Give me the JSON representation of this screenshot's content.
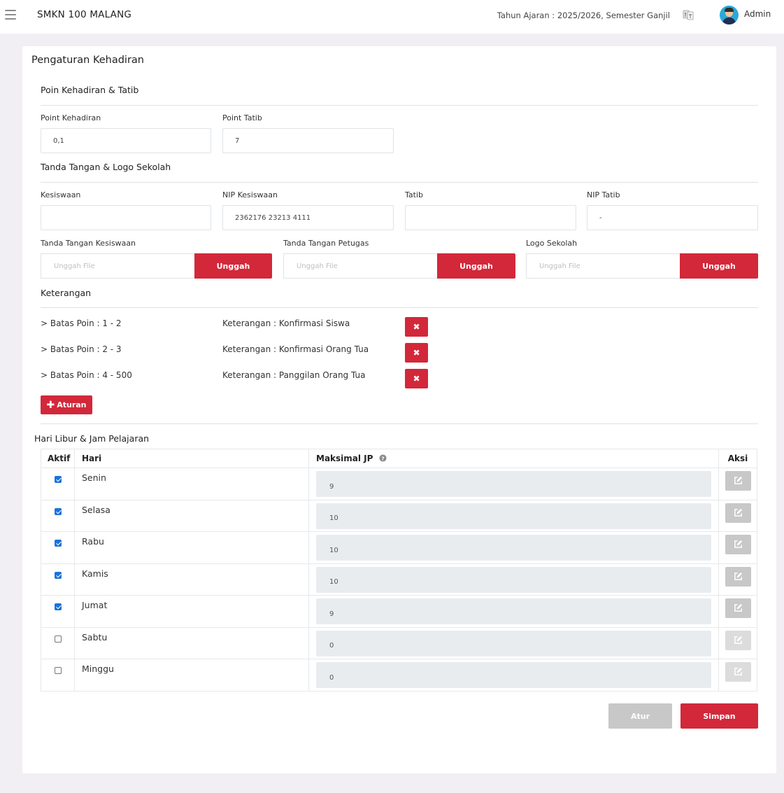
{
  "header": {
    "school_name": "SMKN 100 MALANG",
    "year_info": "Tahun Ajaran : 2025/2026, Semester Ganjil",
    "user_name": "Admin"
  },
  "page": {
    "title": "Pengaturan Kehadiran"
  },
  "points": {
    "section_title": "Poin Kehadiran & Tatib",
    "kehadiran_label": "Point Kehadiran",
    "kehadiran_value": "0,1",
    "tatib_label": "Point Tatib",
    "tatib_value": "7"
  },
  "signature": {
    "section_title": "Tanda Tangan & Logo Sekolah",
    "kesiswaan_label": "Kesiswaan",
    "kesiswaan_value": "",
    "nip_kesiswaan_label": "NIP Kesiswaan",
    "nip_kesiswaan_value": "2362176 23213 4111",
    "tatib_label": "Tatib",
    "tatib_value": "",
    "nip_tatib_label": "NIP Tatib",
    "nip_tatib_value": "-",
    "uploads": [
      {
        "label": "Tanda Tangan Kesiswaan",
        "placeholder": "Unggah File",
        "button": "Unggah"
      },
      {
        "label": "Tanda Tangan Petugas",
        "placeholder": "Unggah File",
        "button": "Unggah"
      },
      {
        "label": "Logo Sekolah",
        "placeholder": "Unggah File",
        "button": "Unggah"
      }
    ]
  },
  "keterangan": {
    "section_title": "Keterangan",
    "rules": [
      {
        "batas": "> Batas Poin : 1 - 2",
        "keterangan": "Keterangan : Konfirmasi Siswa"
      },
      {
        "batas": "> Batas Poin : 2 - 3",
        "keterangan": "Keterangan : Konfirmasi Orang Tua"
      },
      {
        "batas": "> Batas Poin : 4 - 500",
        "keterangan": "Keterangan : Panggilan Orang Tua"
      }
    ],
    "delete_icon": "times-icon",
    "add_label": "Aturan"
  },
  "schedule": {
    "title": "Hari Libur & Jam Pelajaran",
    "columns": [
      "Aktif",
      "Hari",
      "Maksimal JP",
      "Aksi"
    ],
    "rows": [
      {
        "aktif": true,
        "hari": "Senin",
        "jp": "9"
      },
      {
        "aktif": true,
        "hari": "Selasa",
        "jp": "10"
      },
      {
        "aktif": true,
        "hari": "Rabu",
        "jp": "10"
      },
      {
        "aktif": true,
        "hari": "Kamis",
        "jp": "10"
      },
      {
        "aktif": true,
        "hari": "Jumat",
        "jp": "9"
      },
      {
        "aktif": false,
        "hari": "Sabtu",
        "jp": "0"
      },
      {
        "aktif": false,
        "hari": "Minggu",
        "jp": "0"
      }
    ]
  },
  "actions": {
    "atur": "Atur",
    "simpan": "Simpan"
  },
  "colors": {
    "primary": "#d2283a",
    "disabled": "#c8c8c8",
    "checkbox": "#1a73d9"
  }
}
